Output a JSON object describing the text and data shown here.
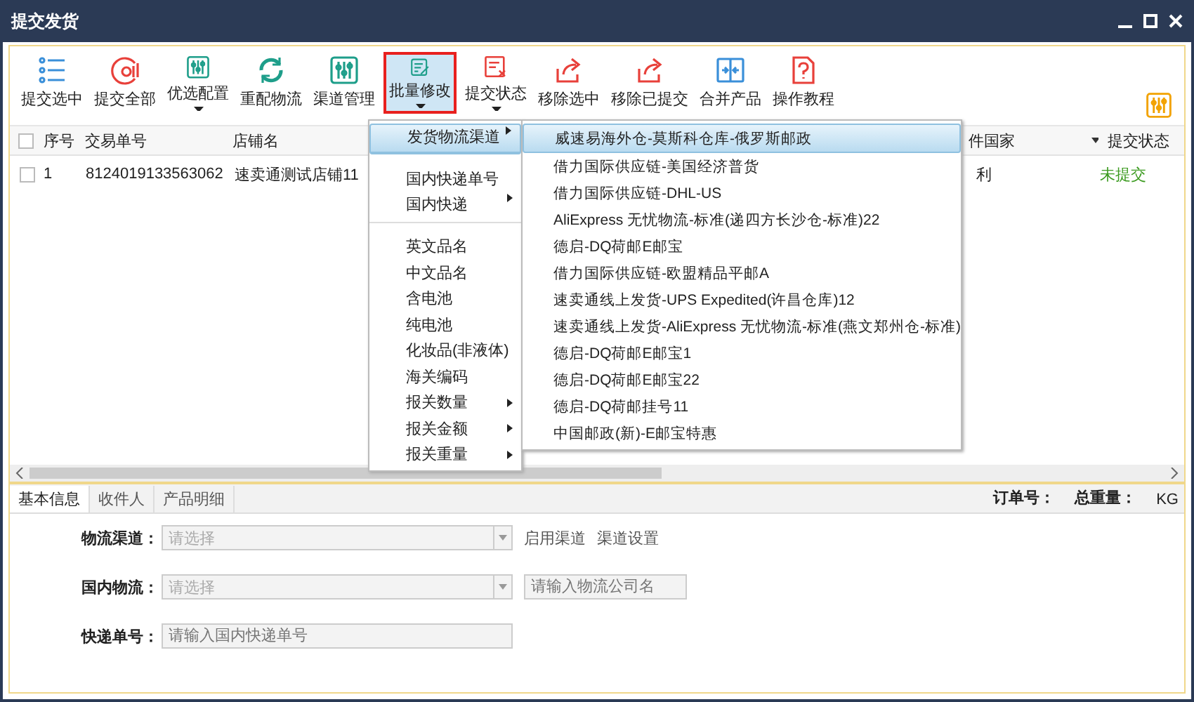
{
  "window": {
    "title": "提交发货"
  },
  "toolbar": {
    "buttons": [
      {
        "label": "提交选中",
        "has_menu": false,
        "selected": false
      },
      {
        "label": "提交全部",
        "has_menu": false,
        "selected": false
      },
      {
        "label": "优选配置",
        "has_menu": true,
        "selected": false
      },
      {
        "label": "重配物流",
        "has_menu": false,
        "selected": false
      },
      {
        "label": "渠道管理",
        "has_menu": false,
        "selected": false
      },
      {
        "label": "批量修改",
        "has_menu": true,
        "selected": true
      },
      {
        "label": "提交状态",
        "has_menu": true,
        "selected": false
      },
      {
        "label": "移除选中",
        "has_menu": false,
        "selected": false
      },
      {
        "label": "移除已提交",
        "has_menu": false,
        "selected": false
      },
      {
        "label": "合并产品",
        "has_menu": false,
        "selected": false
      },
      {
        "label": "操作教程",
        "has_menu": false,
        "selected": false
      }
    ]
  },
  "table": {
    "all_checked": false,
    "columns": [
      {
        "label": "序号"
      },
      {
        "label": "交易单号"
      },
      {
        "label": "店铺名"
      },
      {
        "label": "件国家",
        "has_filter": true
      },
      {
        "label": "提交状态"
      }
    ],
    "rows": [
      {
        "checked": false,
        "cells": [
          "1",
          "8124019133563062",
          "速卖通测试店铺11",
          "利"
        ],
        "status": "未提交"
      }
    ]
  },
  "menu": {
    "items": [
      {
        "label": "发货物流渠道",
        "has_submenu": true,
        "selected": true,
        "separator_after": true
      },
      {
        "label": "国内快递单号",
        "has_submenu": false,
        "selected": false,
        "separator_after": false
      },
      {
        "label": "国内快递",
        "has_submenu": true,
        "selected": false,
        "separator_after": true
      },
      {
        "label": "英文品名",
        "has_submenu": false,
        "selected": false,
        "separator_after": false
      },
      {
        "label": "中文品名",
        "has_submenu": false,
        "selected": false,
        "separator_after": false
      },
      {
        "label": "含电池",
        "has_submenu": false,
        "selected": false,
        "separator_after": false
      },
      {
        "label": "纯电池",
        "has_submenu": false,
        "selected": false,
        "separator_after": false
      },
      {
        "label": "化妆品(非液体)",
        "has_submenu": false,
        "selected": false,
        "separator_after": false
      },
      {
        "label": "海关编码",
        "has_submenu": false,
        "selected": false,
        "separator_after": false
      },
      {
        "label": "报关数量",
        "has_submenu": true,
        "selected": false,
        "separator_after": false
      },
      {
        "label": "报关金额",
        "has_submenu": true,
        "selected": false,
        "separator_after": false
      },
      {
        "label": "报关重量",
        "has_submenu": true,
        "selected": false,
        "separator_after": false
      }
    ]
  },
  "submenu": {
    "items": [
      {
        "label": "威速易海外仓-莫斯科仓库-俄罗斯邮政",
        "selected": true
      },
      {
        "label": "借力国际供应链-美国经济普货",
        "selected": false
      },
      {
        "label": "借力国际供应链-DHL-US",
        "selected": false
      },
      {
        "label": "AliExpress 无忧物流-标准(递四方长沙仓-标准)22",
        "selected": false
      },
      {
        "label": "德启-DQ荷邮E邮宝",
        "selected": false
      },
      {
        "label": "借力国际供应链-欧盟精品平邮A",
        "selected": false
      },
      {
        "label": "速卖通线上发货-UPS Expedited(许昌仓库)12",
        "selected": false
      },
      {
        "label": "速卖通线上发货-AliExpress 无忧物流-标准(燕文郑州仓-标准)",
        "selected": false
      },
      {
        "label": "德启-DQ荷邮E邮宝1",
        "selected": false
      },
      {
        "label": "德启-DQ荷邮E邮宝22",
        "selected": false
      },
      {
        "label": "德启-DQ荷邮挂号11",
        "selected": false
      },
      {
        "label": "中国邮政(新)-E邮宝特惠",
        "selected": false
      }
    ]
  },
  "detail": {
    "tabs": [
      {
        "label": "基本信息",
        "selected": true
      },
      {
        "label": "收件人",
        "selected": false
      },
      {
        "label": "产品明细",
        "selected": false
      }
    ],
    "summary": [
      "订单号：",
      "总重量：",
      "KG"
    ],
    "fields": [
      {
        "label": "物流渠道：",
        "kind": "select",
        "placeholder": "请选择",
        "links": [
          "启用渠道",
          "渠道设置"
        ]
      },
      {
        "label": "国内物流：",
        "kind": "select",
        "placeholder": "请选择",
        "extra_placeholder": "请输入物流公司名"
      },
      {
        "label": "快递单号：",
        "kind": "input",
        "placeholder": "请输入国内快递单号"
      }
    ]
  }
}
